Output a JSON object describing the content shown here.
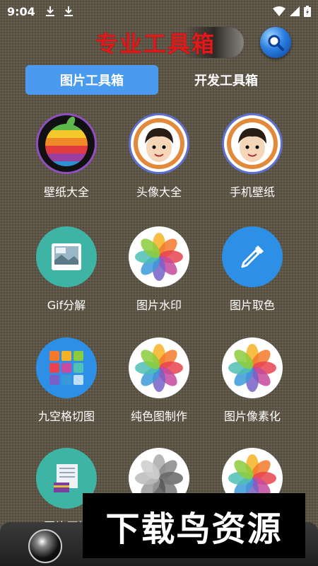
{
  "status_bar": {
    "time": "9:04",
    "icons": [
      "download-icon",
      "download-icon",
      "wifi-icon",
      "signal-icon",
      "battery-icon"
    ]
  },
  "header": {
    "title": "专业工具箱",
    "title_color": "#e0191b",
    "search_icon": "search-icon"
  },
  "tabs": [
    {
      "label": "图片工具箱",
      "active": true
    },
    {
      "label": "开发工具箱",
      "active": false
    }
  ],
  "accent_color": "#4a9af0",
  "tools": [
    {
      "label": "壁纸大全",
      "icon": "rainbow-apple-icon"
    },
    {
      "label": "头像大全",
      "icon": "cartoon-avatar-icon"
    },
    {
      "label": "手机壁纸",
      "icon": "cartoon-avatar-icon"
    },
    {
      "label": "Gif分解",
      "icon": "gif-image-icon"
    },
    {
      "label": "图片水印",
      "icon": "photos-flower-icon"
    },
    {
      "label": "图片取色",
      "icon": "eyedropper-icon"
    },
    {
      "label": "九空格切图",
      "icon": "nine-grid-icon"
    },
    {
      "label": "纯色图制作",
      "icon": "photos-flower-icon"
    },
    {
      "label": "图片像素化",
      "icon": "photos-flower-icon"
    },
    {
      "label": "图片压缩",
      "icon": "compress-icon"
    },
    {
      "label": "",
      "icon": "photos-flower-gray-icon"
    },
    {
      "label": "",
      "icon": "photos-flower-icon"
    }
  ],
  "watermark": {
    "text": "下载鸟资源"
  }
}
